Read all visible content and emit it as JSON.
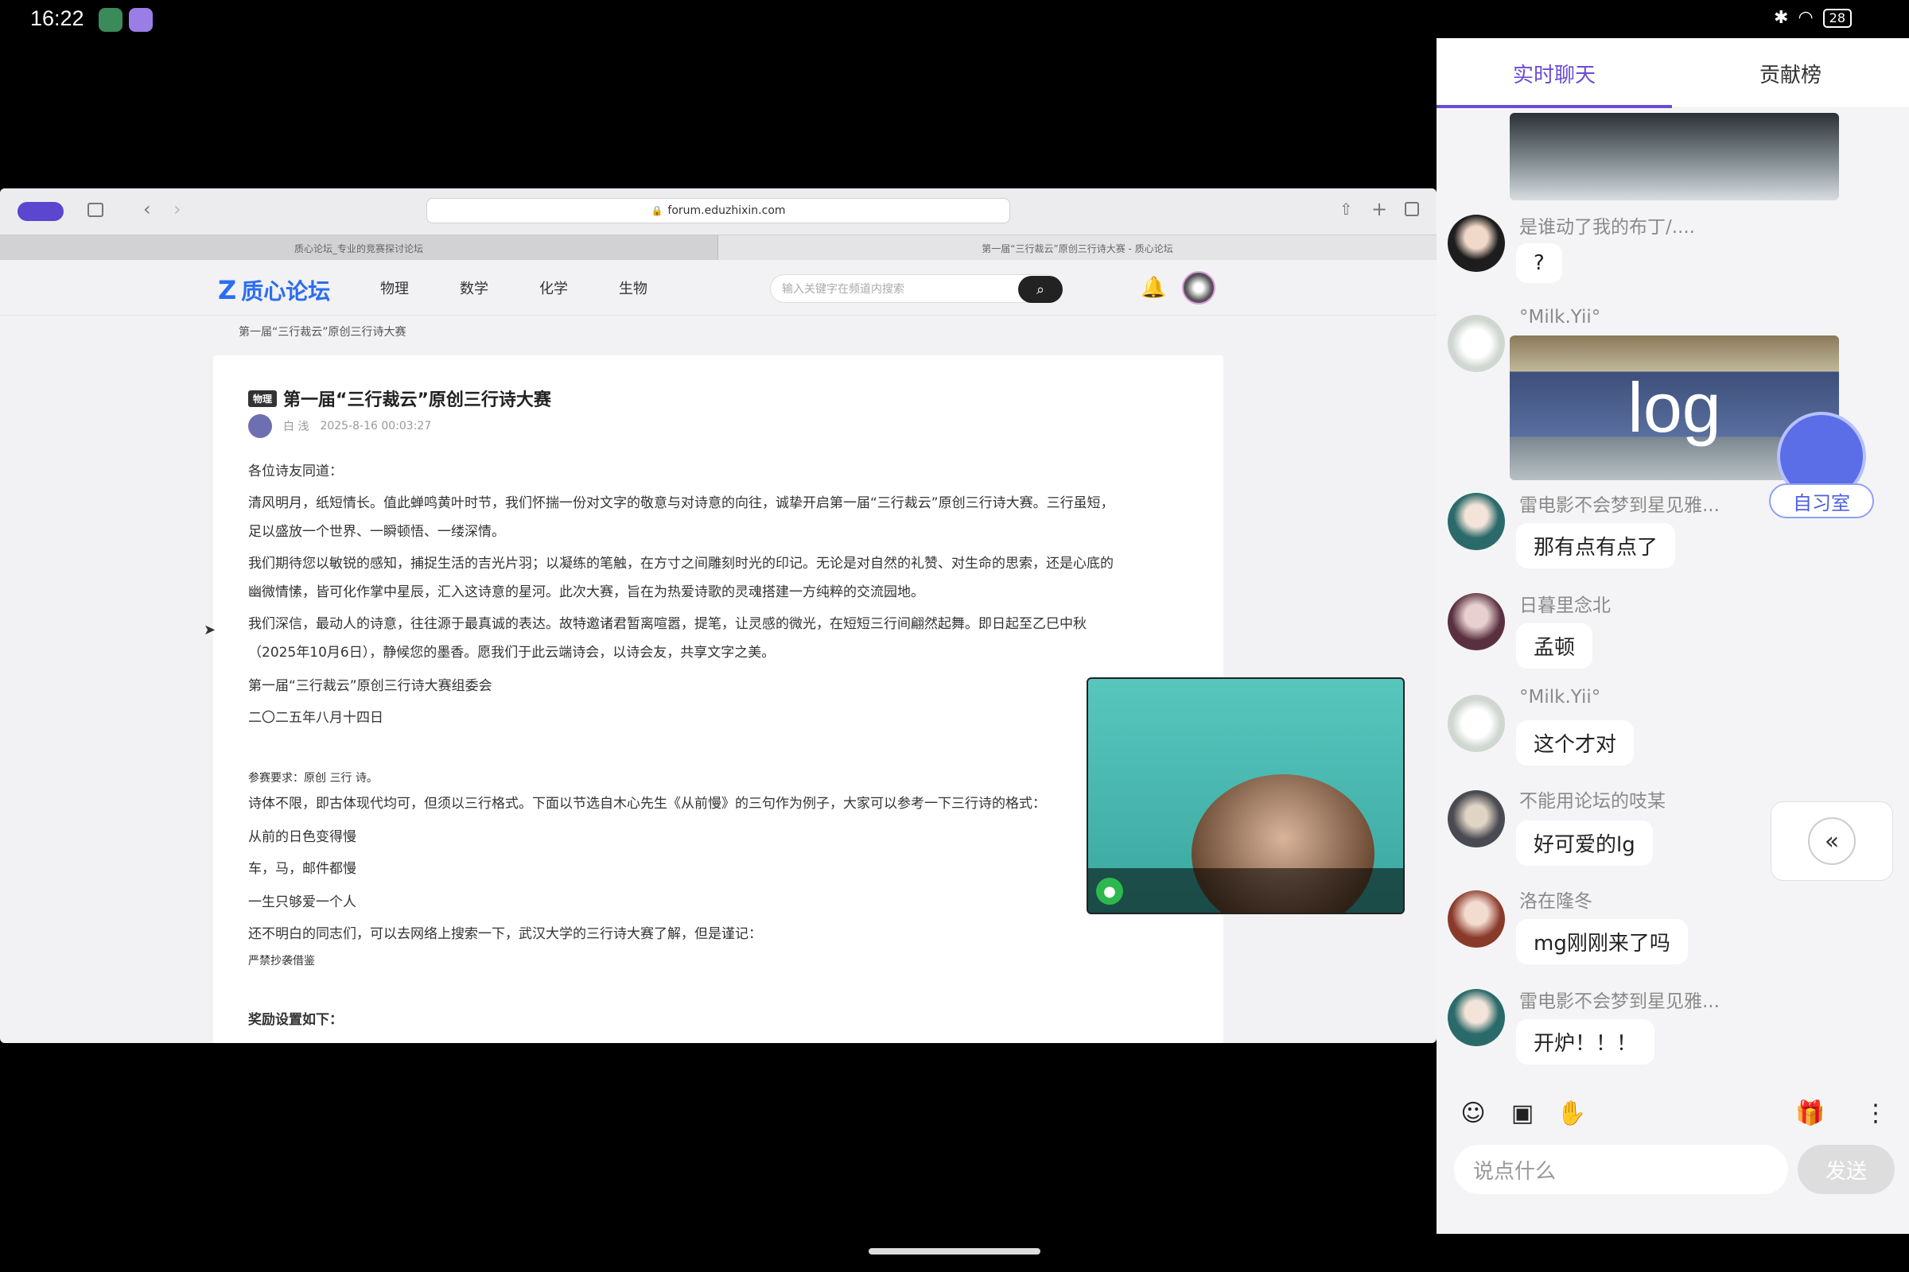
{
  "status_bar": {
    "time": "16:22",
    "battery": "28"
  },
  "browser": {
    "url": "forum.eduzhixin.com",
    "tabs": [
      "质心论坛_专业的竞赛探讨论坛",
      "第一届“三行裁云”原创三行诗大赛 - 质心论坛"
    ],
    "site": {
      "logo": "质心论坛",
      "nav": [
        "物理",
        "数学",
        "化学",
        "生物"
      ],
      "search_placeholder": "输入关键字在频道内搜索"
    },
    "breadcrumb": "第一届“三行裁云”原创三行诗大赛",
    "article": {
      "tag": "物理",
      "title": "第一届“三行裁云”原创三行诗大赛",
      "author": "白 浅",
      "date": "2025-8-16 00:03:27",
      "paragraphs": [
        "各位诗友同道：",
        "清风明月，纸短情长。值此蝉鸣黄叶时节，我们怀揣一份对文字的敬意与对诗意的向往，诚挚开启第一届“三行裁云”原创三行诗大赛。三行虽短，",
        "足以盛放一个世界、一瞬顿悟、一缕深情。",
        "我们期待您以敏锐的感知，捕捉生活的吉光片羽；以凝练的笔触，在方寸之间雕刻时光的印记。无论是对自然的礼赞、对生命的思索，还是心底的",
        "幽微情愫，皆可化作掌中星辰，汇入这诗意的星河。此次大赛，旨在为热爱诗歌的灵魂搭建一方纯粹的交流园地。",
        "我们深信，最动人的诗意，往往源于最真诚的表达。故特邀诸君暂离喧嚣，提笔，让灵感的微光，在短短三行间翩然起舞。即日起至乙巳中秋",
        "（2025年10月6日），静候您的墨香。愿我们于此云端诗会，以诗会友，共享文字之美。",
        "第一届“三行裁云”原创三行诗大赛组委会",
        "二〇二五年八月十四日",
        "参赛要求：原创  三行  诗。",
        "诗体不限，即古体现代均可，但须以三行格式。下面以节选自木心先生《从前慢》的三句作为例子，大家可以参考一下三行诗的格式：",
        "从前的日色变得慢",
        "车，马，邮件都慢",
        "一生只够爱一个人",
        "还不明白的同志们，可以去网络上搜索一下，武汉大学的三行诗大赛了解，但是谨记：",
        "严禁抄袭借鉴",
        "奖励设置如下："
      ]
    }
  },
  "chat": {
    "tabs": [
      "实时聊天",
      "贡献榜"
    ],
    "messages": [
      {
        "user": "是谁动了我的布丁/....",
        "text": "?"
      },
      {
        "user": "°Milk.Yii°",
        "image_text": "log"
      },
      {
        "user": "雷电影不会梦到星见雅...",
        "text": "那有点有点了"
      },
      {
        "user": "日暮里念北",
        "text": "孟顿"
      },
      {
        "user": "°Milk.Yii°",
        "text": "这个才对"
      },
      {
        "user": "不能用论坛的吱某",
        "text": "好可爱的lg"
      },
      {
        "user": "洛在隆冬",
        "text": "mg刚刚来了吗"
      },
      {
        "user": "雷电影不会梦到星见雅...",
        "text": "开炉！！！"
      }
    ],
    "widget_label": "自习室",
    "input_placeholder": "说点什么",
    "send_label": "发送"
  },
  "colors": {
    "accent": "#6a4cd6",
    "logo": "#2b6df0"
  }
}
